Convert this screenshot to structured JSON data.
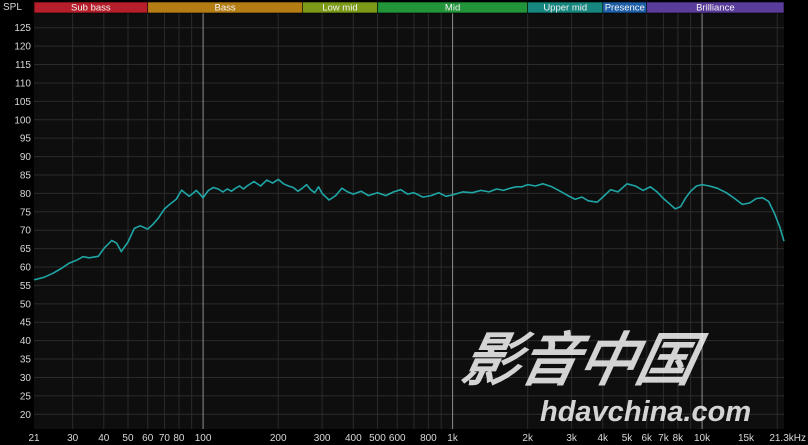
{
  "chart_data": {
    "type": "line",
    "title": "",
    "xlabel": "",
    "ylabel": "SPL",
    "x_scale": "log",
    "xlim": [
      21,
      21300
    ],
    "ylim": [
      16,
      129
    ],
    "grid": true,
    "y_ticks": [
      20,
      25,
      30,
      35,
      40,
      45,
      50,
      55,
      60,
      65,
      70,
      75,
      80,
      85,
      90,
      95,
      100,
      105,
      110,
      115,
      120,
      125
    ],
    "x_ticks": [
      {
        "value": 21,
        "label": "21"
      },
      {
        "value": 30,
        "label": "30"
      },
      {
        "value": 40,
        "label": "40"
      },
      {
        "value": 50,
        "label": "50"
      },
      {
        "value": 60,
        "label": "60"
      },
      {
        "value": 70,
        "label": "70"
      },
      {
        "value": 80,
        "label": "80"
      },
      {
        "value": 100,
        "label": "100"
      },
      {
        "value": 200,
        "label": "200"
      },
      {
        "value": 300,
        "label": "300"
      },
      {
        "value": 400,
        "label": "400"
      },
      {
        "value": 500,
        "label": "500"
      },
      {
        "value": 600,
        "label": "600"
      },
      {
        "value": 800,
        "label": "800"
      },
      {
        "value": 1000,
        "label": "1k"
      },
      {
        "value": 2000,
        "label": "2k"
      },
      {
        "value": 3000,
        "label": "3k"
      },
      {
        "value": 4000,
        "label": "4k"
      },
      {
        "value": 5000,
        "label": "5k"
      },
      {
        "value": 6000,
        "label": "6k"
      },
      {
        "value": 7000,
        "label": "7k"
      },
      {
        "value": 8000,
        "label": "8k"
      },
      {
        "value": 10000,
        "label": "10k"
      },
      {
        "value": 15000,
        "label": "15k"
      },
      {
        "value": 21300,
        "label": "21.3kHz"
      }
    ],
    "major_lines": [
      100,
      1000,
      10000
    ],
    "bands": [
      {
        "name": "Sub bass",
        "from": 21,
        "to": 60,
        "color": "#b51e2a"
      },
      {
        "name": "Bass",
        "from": 60,
        "to": 250,
        "color": "#b47d14"
      },
      {
        "name": "Low mid",
        "from": 250,
        "to": 500,
        "color": "#7c9a18"
      },
      {
        "name": "Mid",
        "from": 500,
        "to": 2000,
        "color": "#22953a"
      },
      {
        "name": "Upper mid",
        "from": 2000,
        "to": 4000,
        "color": "#16867e"
      },
      {
        "name": "Presence",
        "from": 4000,
        "to": 6000,
        "color": "#1e5fa8"
      },
      {
        "name": "Brilliance",
        "from": 6000,
        "to": 21300,
        "color": "#5a3c9a"
      }
    ],
    "series": [
      {
        "color": "#1fa5a5",
        "x": [
          21,
          23,
          25,
          27,
          29,
          31,
          33,
          35,
          38,
          40,
          43,
          45,
          47,
          50,
          53,
          56,
          60,
          63,
          66,
          70,
          74,
          78,
          82,
          85,
          88,
          91,
          94,
          97,
          100,
          105,
          110,
          115,
          120,
          125,
          130,
          135,
          140,
          145,
          150,
          160,
          170,
          180,
          190,
          200,
          210,
          220,
          230,
          240,
          250,
          260,
          270,
          280,
          290,
          300,
          320,
          340,
          360,
          380,
          400,
          430,
          460,
          500,
          540,
          580,
          620,
          660,
          700,
          760,
          820,
          880,
          940,
          1000,
          1100,
          1200,
          1300,
          1400,
          1500,
          1600,
          1700,
          1800,
          1900,
          2000,
          2150,
          2300,
          2500,
          2700,
          2900,
          3100,
          3300,
          3500,
          3800,
          4000,
          4300,
          4600,
          5000,
          5400,
          5800,
          6200,
          6600,
          7000,
          7400,
          7800,
          8200,
          8600,
          9000,
          9500,
          10000,
          10700,
          11500,
          12500,
          13500,
          14500,
          15500,
          16500,
          17500,
          18500,
          19500,
          20500,
          21300
        ],
        "values": [
          56.5,
          57.2,
          58.3,
          59.6,
          61.0,
          61.8,
          62.8,
          62.5,
          62.9,
          65.0,
          67.2,
          66.5,
          64.2,
          66.8,
          70.5,
          71.2,
          70.3,
          71.6,
          73.2,
          75.8,
          77.2,
          78.4,
          80.9,
          80.0,
          79.2,
          80.0,
          80.8,
          79.8,
          78.8,
          80.8,
          81.6,
          81.2,
          80.4,
          81.2,
          80.6,
          81.4,
          82.0,
          81.2,
          82.0,
          83.2,
          82.0,
          83.6,
          82.8,
          83.8,
          82.6,
          82.0,
          81.6,
          80.6,
          81.4,
          82.4,
          81.0,
          80.2,
          81.8,
          80.0,
          78.2,
          79.4,
          81.4,
          80.4,
          79.8,
          80.6,
          79.4,
          80.2,
          79.4,
          80.4,
          81.0,
          79.8,
          80.2,
          79.0,
          79.4,
          80.2,
          79.2,
          79.6,
          80.4,
          80.2,
          80.8,
          80.4,
          81.2,
          80.8,
          81.4,
          81.8,
          81.8,
          82.4,
          82.0,
          82.6,
          81.8,
          80.6,
          79.4,
          78.4,
          79.0,
          78.0,
          77.6,
          79.0,
          81.0,
          80.4,
          82.6,
          82.0,
          80.8,
          81.8,
          80.4,
          78.6,
          77.2,
          75.8,
          76.4,
          78.8,
          80.6,
          82.0,
          82.4,
          82.0,
          81.4,
          80.2,
          78.6,
          77.0,
          77.4,
          78.6,
          78.8,
          77.8,
          74.6,
          70.8,
          67.0
        ]
      }
    ]
  },
  "watermark": {
    "chinese_text": "影音中国",
    "url_text": "hdavchina.com"
  }
}
